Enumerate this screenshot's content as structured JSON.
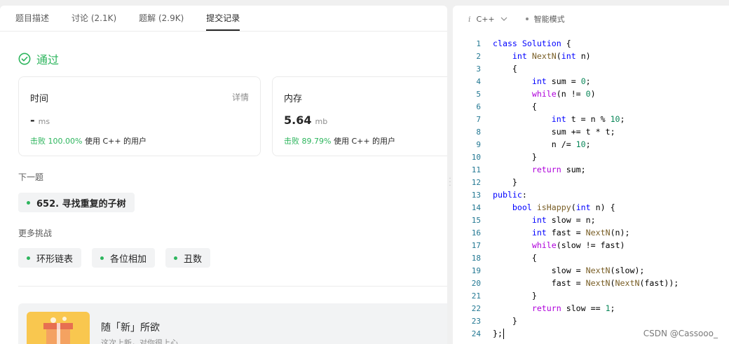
{
  "tabs": [
    {
      "label": "题目描述",
      "active": false
    },
    {
      "label": "讨论 (2.1K)",
      "active": false
    },
    {
      "label": "题解 (2.9K)",
      "active": false
    },
    {
      "label": "提交记录",
      "active": true
    }
  ],
  "status": {
    "text": "通过",
    "color": "#2db55d"
  },
  "time_card": {
    "title": "时间",
    "detail": "详情",
    "value": "-",
    "unit": "ms",
    "beat_pct": "击败 100.00%",
    "beat_text": "使用 C++ 的用户"
  },
  "memory_card": {
    "title": "内存",
    "value": "5.64",
    "unit": "mb",
    "beat_pct": "击败 89.79%",
    "beat_text": "使用 C++ 的用户"
  },
  "next_problem": {
    "label": "下一题",
    "item": "652. 寻找重复的子树"
  },
  "more_challenges": {
    "label": "更多挑战",
    "items": [
      "环形链表",
      "各位相加",
      "丑数"
    ]
  },
  "promo": {
    "title": "随「新」所欲",
    "subtitle": "这次上新，对你很上心"
  },
  "editor": {
    "language": "C++",
    "mode": "智能模式"
  },
  "code_lines": [
    "class Solution {",
    "    int NextN(int n)",
    "    {",
    "        int sum = 0;",
    "        while(n != 0)",
    "        {",
    "            int t = n % 10;",
    "            sum += t * t;",
    "            n /= 10;",
    "        }",
    "        return sum;",
    "    }",
    "public:",
    "    bool isHappy(int n) {",
    "        int slow = n;",
    "        int fast = NextN(n);",
    "        while(slow != fast)",
    "        {",
    "            slow = NextN(slow);",
    "            fast = NextN(NextN(fast));",
    "        }",
    "        return slow == 1;",
    "    }",
    "};"
  ],
  "watermark": "CSDN @Cassooo_"
}
